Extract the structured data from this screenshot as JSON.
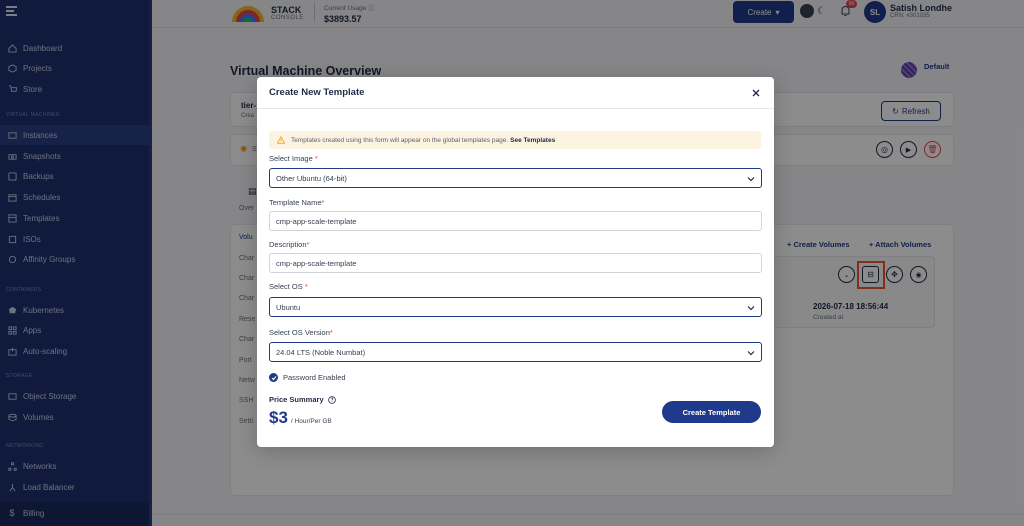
{
  "sidebar": {
    "items": [
      {
        "label": "Dashboard",
        "icon": "home-icon"
      },
      {
        "label": "Projects",
        "icon": "cube-icon"
      },
      {
        "label": "Store",
        "icon": "cart-icon"
      },
      {
        "label": "Instances",
        "icon": "server-icon"
      },
      {
        "label": "Snapshots",
        "icon": "camera-icon"
      },
      {
        "label": "Backups",
        "icon": "disk-icon"
      },
      {
        "label": "Schedules",
        "icon": "calendar-icon"
      },
      {
        "label": "Templates",
        "icon": "template-icon"
      },
      {
        "label": "ISOs",
        "icon": "iso-icon"
      },
      {
        "label": "Affinity Groups",
        "icon": "group-icon"
      },
      {
        "label": "Kubernetes",
        "icon": "kubernetes-icon"
      },
      {
        "label": "Apps",
        "icon": "apps-icon"
      },
      {
        "label": "Auto-scaling",
        "icon": "scale-icon"
      },
      {
        "label": "Object Storage",
        "icon": "storage-icon"
      },
      {
        "label": "Volumes",
        "icon": "volume-icon"
      },
      {
        "label": "Networks",
        "icon": "network-icon"
      },
      {
        "label": "Load Balancer",
        "icon": "balancer-icon"
      },
      {
        "label": "Billing",
        "icon": "dollar-icon"
      }
    ],
    "sections": [
      "VIRTUAL MACHINES",
      "CONTAINERS",
      "STORAGE",
      "NETWORKING"
    ]
  },
  "header": {
    "logo_line1": "STACK",
    "logo_line2": "CONSOLE",
    "usage_label": "Current Usage",
    "usage_value": "$3893.57",
    "create_label": "Create",
    "notifications": "99",
    "avatar_initials": "SL",
    "user_name": "Satish Londhe",
    "user_crn": "CRN: #301035"
  },
  "page": {
    "title": "Virtual Machine Overview",
    "default_label": "Default",
    "refresh_label": "Refresh",
    "create_volumes": "+ Create Volumes",
    "attach_volumes": "+ Attach Volumes",
    "created_at_value": "2026-07-18 18:56:44",
    "created_at_label": "Created at",
    "partial_texts": [
      "tier-",
      "Crea",
      "S",
      "Over",
      "Volu",
      "Char",
      "Char",
      "Char",
      "Rese",
      "Char",
      "Port",
      "Netw",
      "SSH",
      "Setti"
    ]
  },
  "modal": {
    "title": "Create New Template",
    "notice_text": "Templates created using this form will appear on the global templates page.",
    "notice_link": "See Templates",
    "select_image_label": "Select Image",
    "select_image_value": "Other Ubuntu (64-bit)",
    "template_name_label": "Template Name",
    "template_name_value": "cmp-app-scale-template",
    "description_label": "Description",
    "description_value": "cmp-app-scale-template",
    "select_os_label": "Select OS",
    "select_os_value": "Ubuntu",
    "select_os_version_label": "Select OS Version",
    "select_os_version_value": "24.04 LTS (Noble Numbat)",
    "password_enabled_label": "Password Enabled",
    "price_summary_label": "Price Summary",
    "price_amount": "$3",
    "price_unit": "/ Hour/Per GB",
    "create_button": "Create Template",
    "required_mark": "*"
  },
  "colors": {
    "sidebar_bg": "#1e3170",
    "primary": "#1f3a8a",
    "notice_bg": "#fdf3e1",
    "highlight": "#f0522e"
  }
}
